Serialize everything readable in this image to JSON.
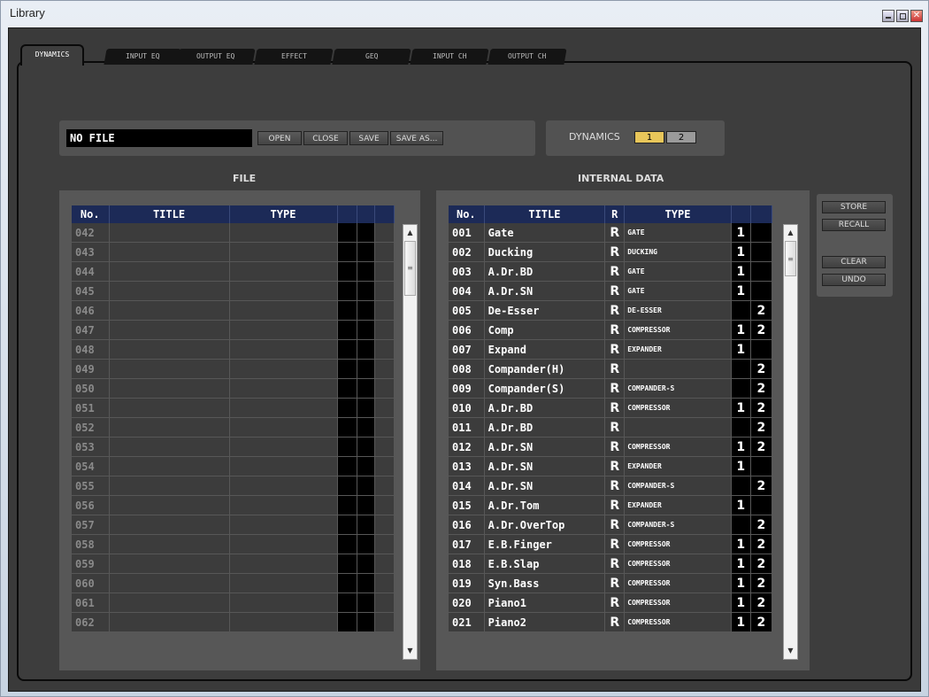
{
  "window": {
    "title": "Library"
  },
  "tabs": [
    "DYNAMICS",
    "INPUT EQ",
    "OUTPUT EQ",
    "EFFECT",
    "GEQ",
    "INPUT CH",
    "OUTPUT CH"
  ],
  "file_bar": {
    "file_name": "NO FILE",
    "open": "OPEN",
    "close": "CLOSE",
    "save": "SAVE",
    "save_as": "SAVE AS..."
  },
  "dynamics": {
    "label": "DYNAMICS",
    "btn1": "1",
    "btn2": "2",
    "btn1_color": "#e8c65a",
    "btn2_color": "#9a9a9a"
  },
  "file_section": {
    "label": "FILE",
    "headers": [
      "No.",
      "TITLE",
      "TYPE"
    ],
    "rows": [
      "042",
      "043",
      "044",
      "045",
      "046",
      "047",
      "048",
      "049",
      "050",
      "051",
      "052",
      "053",
      "054",
      "055",
      "056",
      "057",
      "058",
      "059",
      "060",
      "061",
      "062"
    ]
  },
  "internal_section": {
    "label": "INTERNAL DATA",
    "headers": [
      "No.",
      "TITLE",
      "R",
      "TYPE"
    ],
    "rows": [
      {
        "no": "001",
        "title": "Gate",
        "r": "R",
        "type": "GATE",
        "c1": "1",
        "c2": ""
      },
      {
        "no": "002",
        "title": "Ducking",
        "r": "R",
        "type": "DUCKING",
        "c1": "1",
        "c2": ""
      },
      {
        "no": "003",
        "title": "A.Dr.BD",
        "r": "R",
        "type": "GATE",
        "c1": "1",
        "c2": ""
      },
      {
        "no": "004",
        "title": "A.Dr.SN",
        "r": "R",
        "type": "GATE",
        "c1": "1",
        "c2": ""
      },
      {
        "no": "005",
        "title": "De-Esser",
        "r": "R",
        "type": "DE-ESSER",
        "c1": "",
        "c2": "2"
      },
      {
        "no": "006",
        "title": "Comp",
        "r": "R",
        "type": "COMPRESSOR",
        "c1": "1",
        "c2": "2"
      },
      {
        "no": "007",
        "title": "Expand",
        "r": "R",
        "type": "EXPANDER",
        "c1": "1",
        "c2": ""
      },
      {
        "no": "008",
        "title": "Compander(H)",
        "r": "R",
        "type": "",
        "c1": "",
        "c2": "2"
      },
      {
        "no": "009",
        "title": "Compander(S)",
        "r": "R",
        "type": "COMPANDER-S",
        "c1": "",
        "c2": "2"
      },
      {
        "no": "010",
        "title": "A.Dr.BD",
        "r": "R",
        "type": "COMPRESSOR",
        "c1": "1",
        "c2": "2"
      },
      {
        "no": "011",
        "title": "A.Dr.BD",
        "r": "R",
        "type": "",
        "c1": "",
        "c2": "2"
      },
      {
        "no": "012",
        "title": "A.Dr.SN",
        "r": "R",
        "type": "COMPRESSOR",
        "c1": "1",
        "c2": "2"
      },
      {
        "no": "013",
        "title": "A.Dr.SN",
        "r": "R",
        "type": "EXPANDER",
        "c1": "1",
        "c2": ""
      },
      {
        "no": "014",
        "title": "A.Dr.SN",
        "r": "R",
        "type": "COMPANDER-S",
        "c1": "",
        "c2": "2"
      },
      {
        "no": "015",
        "title": "A.Dr.Tom",
        "r": "R",
        "type": "EXPANDER",
        "c1": "1",
        "c2": ""
      },
      {
        "no": "016",
        "title": "A.Dr.OverTop",
        "r": "R",
        "type": "COMPANDER-S",
        "c1": "",
        "c2": "2"
      },
      {
        "no": "017",
        "title": "E.B.Finger",
        "r": "R",
        "type": "COMPRESSOR",
        "c1": "1",
        "c2": "2"
      },
      {
        "no": "018",
        "title": "E.B.Slap",
        "r": "R",
        "type": "COMPRESSOR",
        "c1": "1",
        "c2": "2"
      },
      {
        "no": "019",
        "title": "Syn.Bass",
        "r": "R",
        "type": "COMPRESSOR",
        "c1": "1",
        "c2": "2"
      },
      {
        "no": "020",
        "title": "Piano1",
        "r": "R",
        "type": "COMPRESSOR",
        "c1": "1",
        "c2": "2"
      },
      {
        "no": "021",
        "title": "Piano2",
        "r": "R",
        "type": "COMPRESSOR",
        "c1": "1",
        "c2": "2"
      }
    ]
  },
  "side_buttons": {
    "store": "STORE",
    "recall": "RECALL",
    "clear": "CLEAR",
    "undo": "UNDO"
  }
}
